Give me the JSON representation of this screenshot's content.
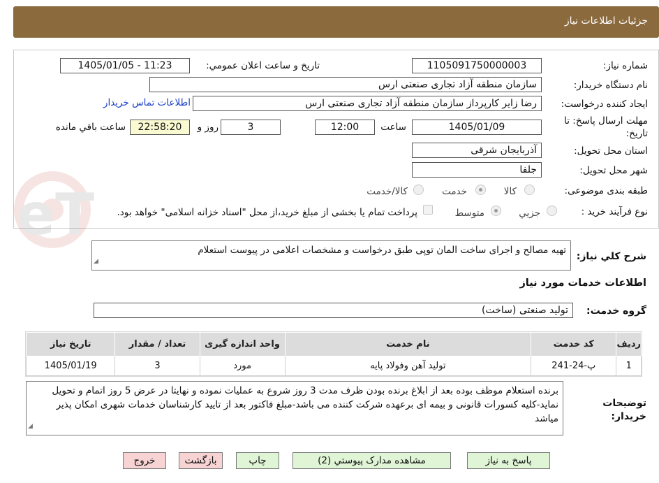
{
  "header": {
    "title": "جزئیات اطلاعات نیاز"
  },
  "form": {
    "need_number_label": "شماره نیاز:",
    "need_number": "1105091750000003",
    "announce_label": "تاریخ و ساعت اعلان عمومي:",
    "announce_value": "1405/01/05 - 11:23",
    "buyer_org_label": "نام دستگاه خریدار:",
    "buyer_org": "سازمان منطقه آزاد تجاری صنعتی ارس",
    "creator_label": "ایجاد کننده درخواست:",
    "creator": "رضا زایر کارپرداز سازمان منطقه آزاد تجاری صنعتی ارس",
    "contact_link": "اطلاعات تماس خریدار",
    "deadline_label_1": "مهلت ارسال پاسخ: تا",
    "deadline_label_2": "تاریخ:",
    "deadline_date": "1405/01/09",
    "time_label": "ساعت",
    "deadline_time": "12:00",
    "days": "3",
    "days_label": "روز و",
    "remaining": "22:58:20",
    "remaining_label": "ساعت باقي مانده",
    "province_label": "استان محل تحویل:",
    "province": "آذربایجان شرقی",
    "city_label": "شهر محل تحویل:",
    "city": "جلفا",
    "category_label": "طبقه بندی موضوعی:",
    "category_options": [
      "کالا",
      "خدمت",
      "کالا/خدمت"
    ],
    "purchase_label": "نوع فرآیند خرید :",
    "purchase_options": [
      "جزيي",
      "متوسط"
    ],
    "payment_note": "پرداخت تمام یا بخشی از مبلغ خرید،از محل \"اسناد خزانه اسلامی\" خواهد بود."
  },
  "description": {
    "label": "شرح کلي نیاز:",
    "text": "تهیه مصالح و اجرای ساخت المان توپی طبق درخواست و مشخصات اعلامی در پیوست استعلام"
  },
  "services": {
    "section_title": "اطلاعات خدمات مورد نیاز",
    "group_label": "گروه خدمت:",
    "group_value": "تولید صنعتی (ساخت)",
    "columns": [
      "ردیف",
      "کد خدمت",
      "نام خدمت",
      "واحد اندازه گیری",
      "تعداد / مقدار",
      "تاریخ نیاز"
    ],
    "rows": [
      [
        "1",
        "پ-24-241",
        "تولید آهن وفولاد پایه",
        "مورد",
        "3",
        "1405/01/19"
      ]
    ]
  },
  "buyer_notes": {
    "label_1": "توضیحات",
    "label_2": "خریدار:",
    "text": "برنده استعلام موظف بوده بعد از ابلاغ برنده بودن ظرف مدت 3 روز شروع به عملیات نموده و نهایتا در عرض 5 روز اتمام و تحویل نماید-کلیه کسورات قانونی و بیمه ای برعهده شرکت کننده می باشد-مبلغ فاکتور بعد از تایید کارشناسان  خدمات شهری امکان پذیر میاشد"
  },
  "buttons": {
    "reply": "پاسخ به نیاز",
    "docs": "مشاهده مدارک پیوستي (2)",
    "print": "چاپ",
    "back": "بازگشت",
    "exit": "خروج"
  },
  "watermark_text": "AriaTender.neT",
  "colors": {
    "header_bg": "#8b6a3e",
    "button_green": "#dff5d6",
    "button_pink": "#f7d3d3",
    "link": "#1a3fc9",
    "remaining_bg": "#fafad2"
  }
}
